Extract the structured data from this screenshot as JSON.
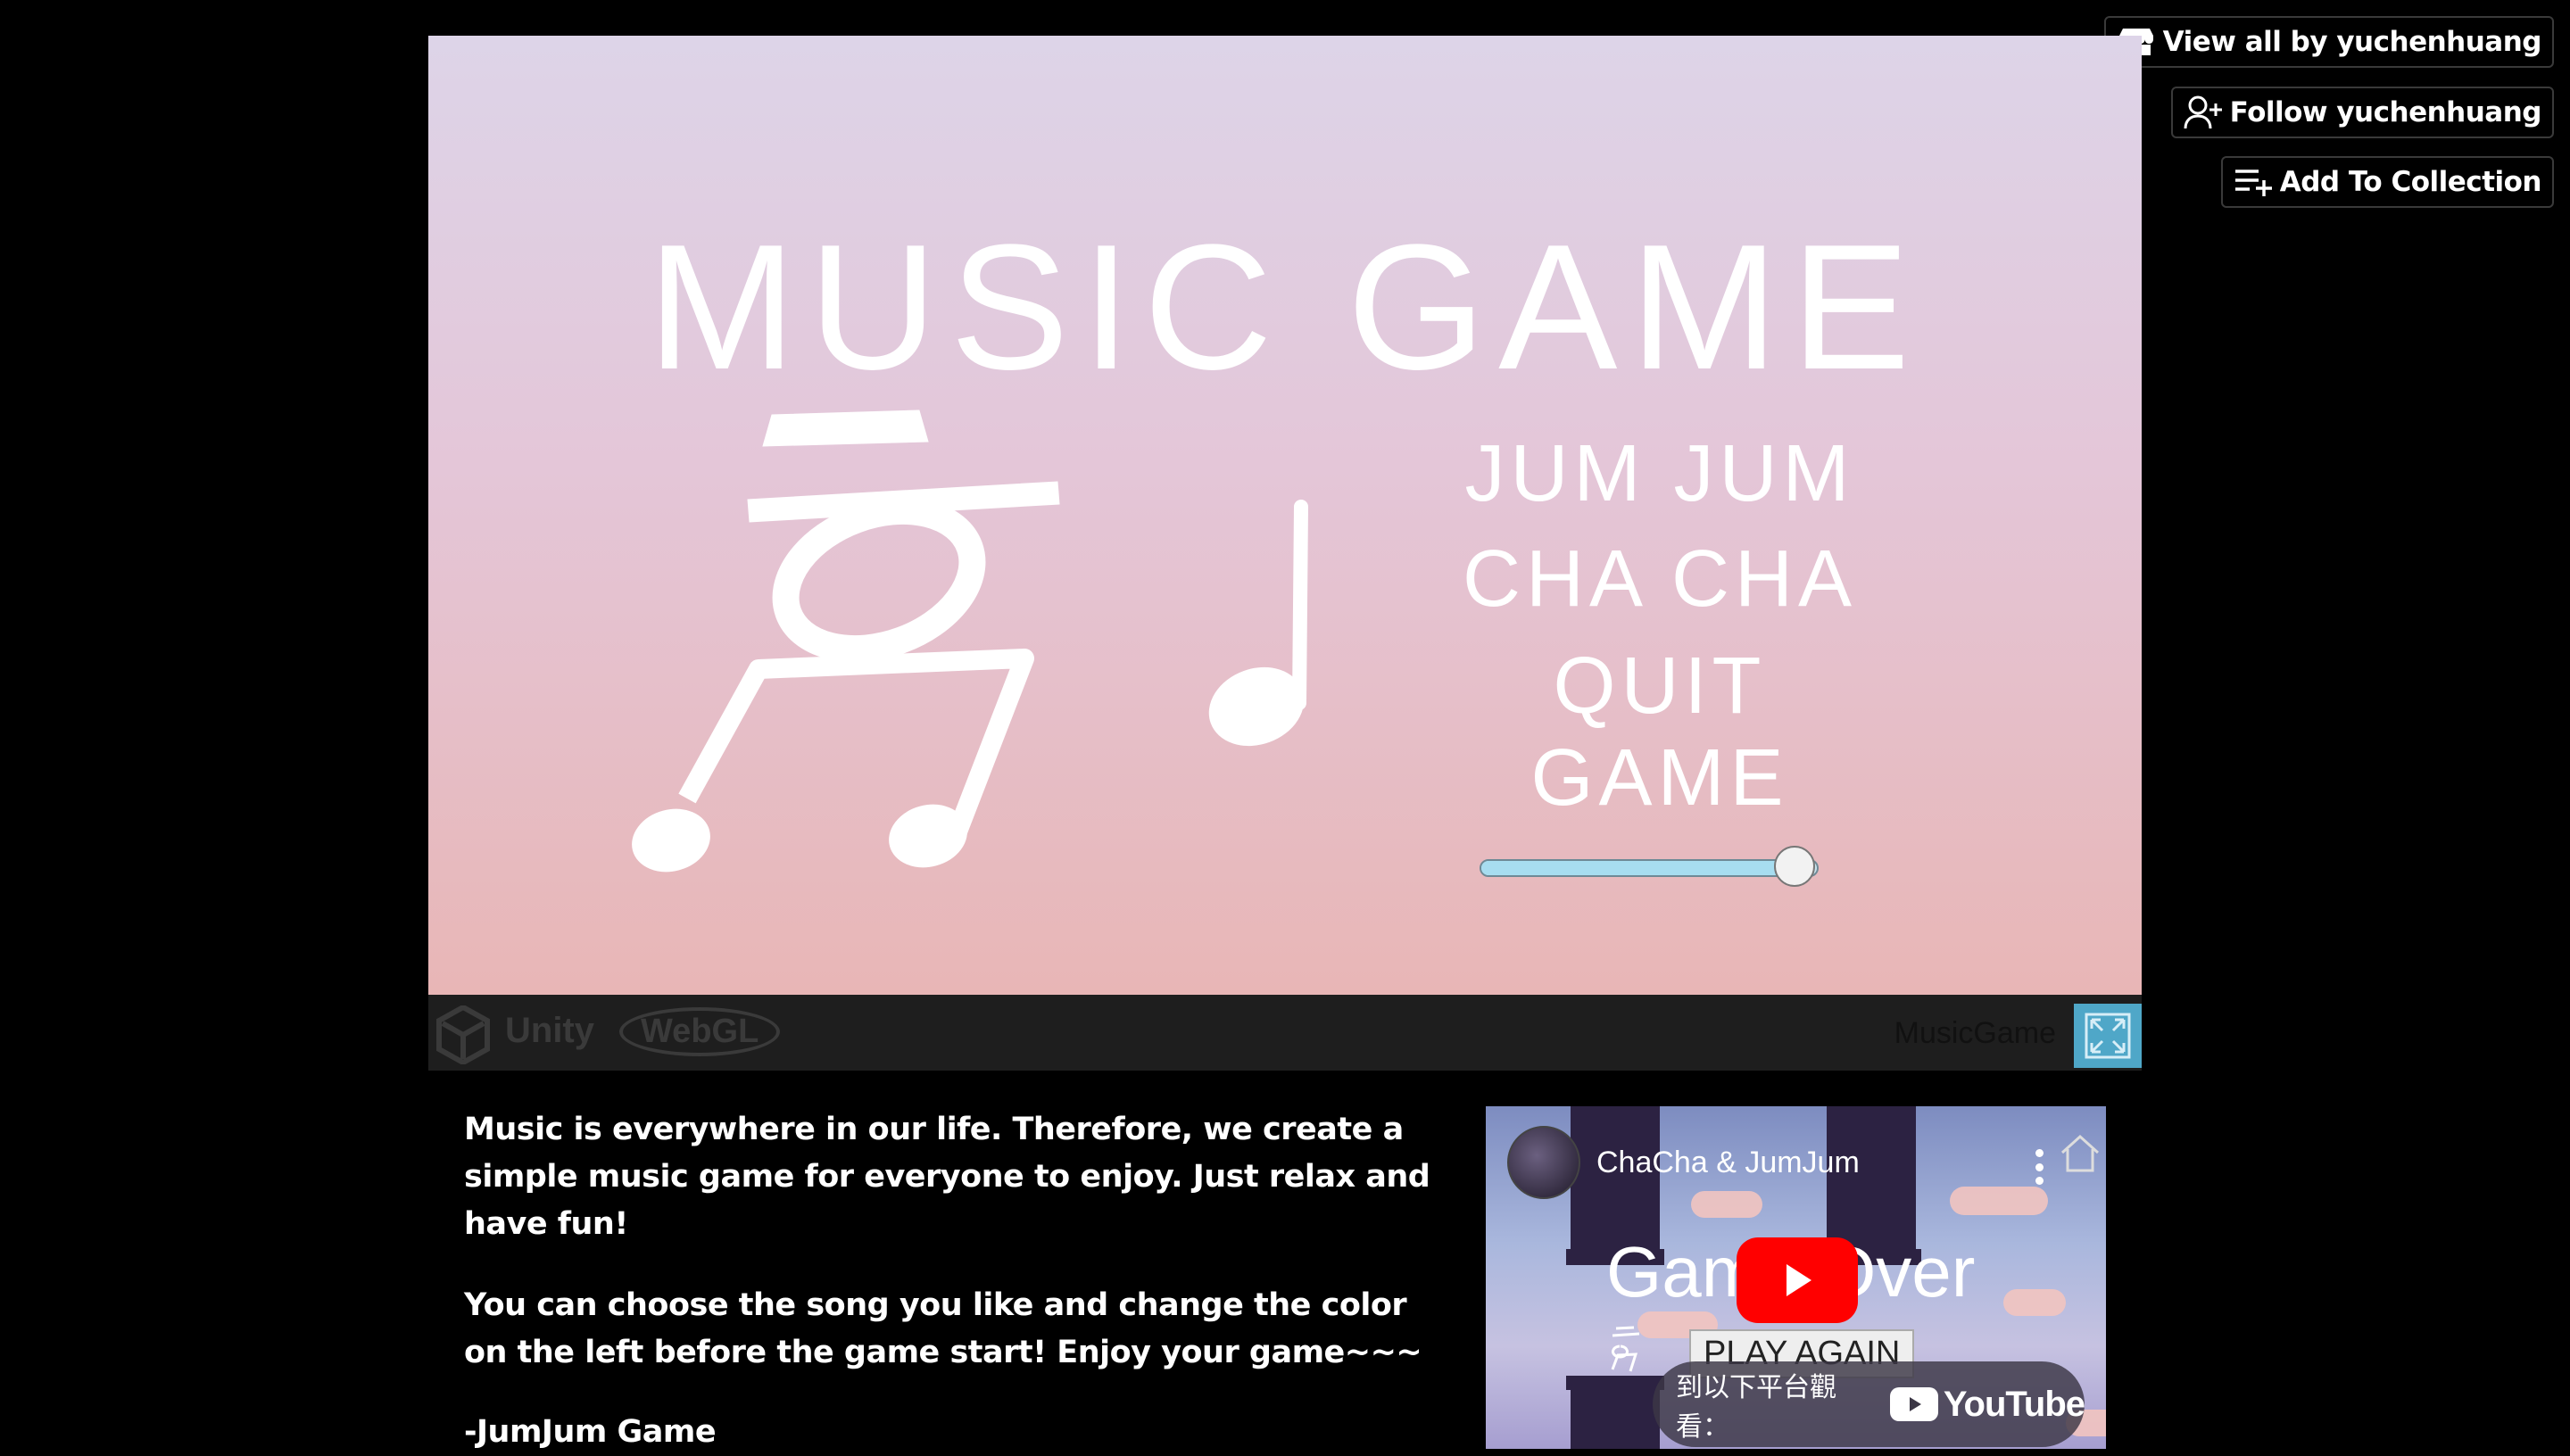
{
  "sidebar": {
    "view_all": "View all by yuchenhuang",
    "follow": "Follow yuchenhuang",
    "add_collection": "Add To Collection"
  },
  "game": {
    "title": "MUSIC GAME",
    "menu": [
      "JUM JUM",
      "CHA CHA",
      "QUIT GAME"
    ],
    "volume": 0.93
  },
  "player_bar": {
    "engine": "Unity",
    "platform": "WebGL",
    "game_name": "MusicGame"
  },
  "description": {
    "paragraphs": [
      "Music is everywhere in our life.  Therefore, we create a simple music game for everyone to enjoy.  Just relax and have fun!",
      "You can choose the song you like and change the color on the left before the game start! Enjoy your game~~~",
      "-JumJum Game"
    ]
  },
  "video": {
    "title": "ChaCha & JumJum",
    "overlay_game_over": "Game Over",
    "overlay_play_again": "PLAY AGAIN",
    "watch_on_label": "到以下平台觀看：",
    "watch_on_brand": "YouTube"
  }
}
